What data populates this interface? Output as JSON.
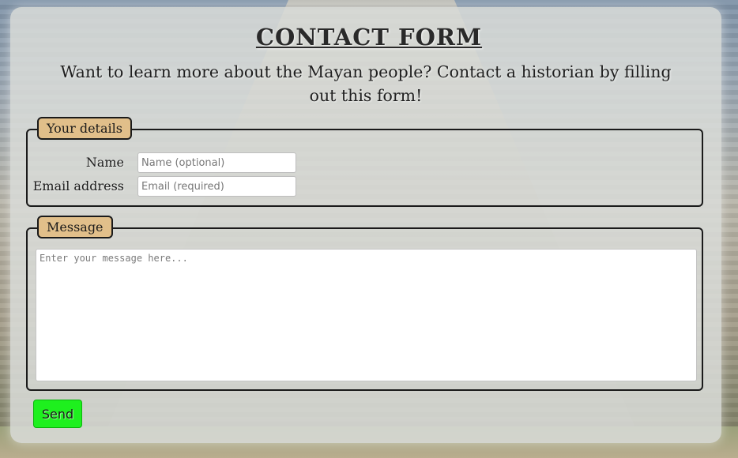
{
  "page": {
    "title": "CONTACT FORM",
    "intro": "Want to learn more about the Mayan people? Contact a historian by filling out this form!"
  },
  "details": {
    "legend": "Your details",
    "name": {
      "label": "Name",
      "placeholder": "Name (optional)",
      "value": ""
    },
    "email": {
      "label": "Email address",
      "placeholder": "Email (required)",
      "value": ""
    }
  },
  "message": {
    "legend": "Message",
    "placeholder": "Enter your message here...",
    "value": ""
  },
  "actions": {
    "send_label": "Send"
  },
  "colors": {
    "legend_bg": "#e1bf8a",
    "send_bg": "#1ef01e",
    "panel_bg": "#dadcd8"
  }
}
